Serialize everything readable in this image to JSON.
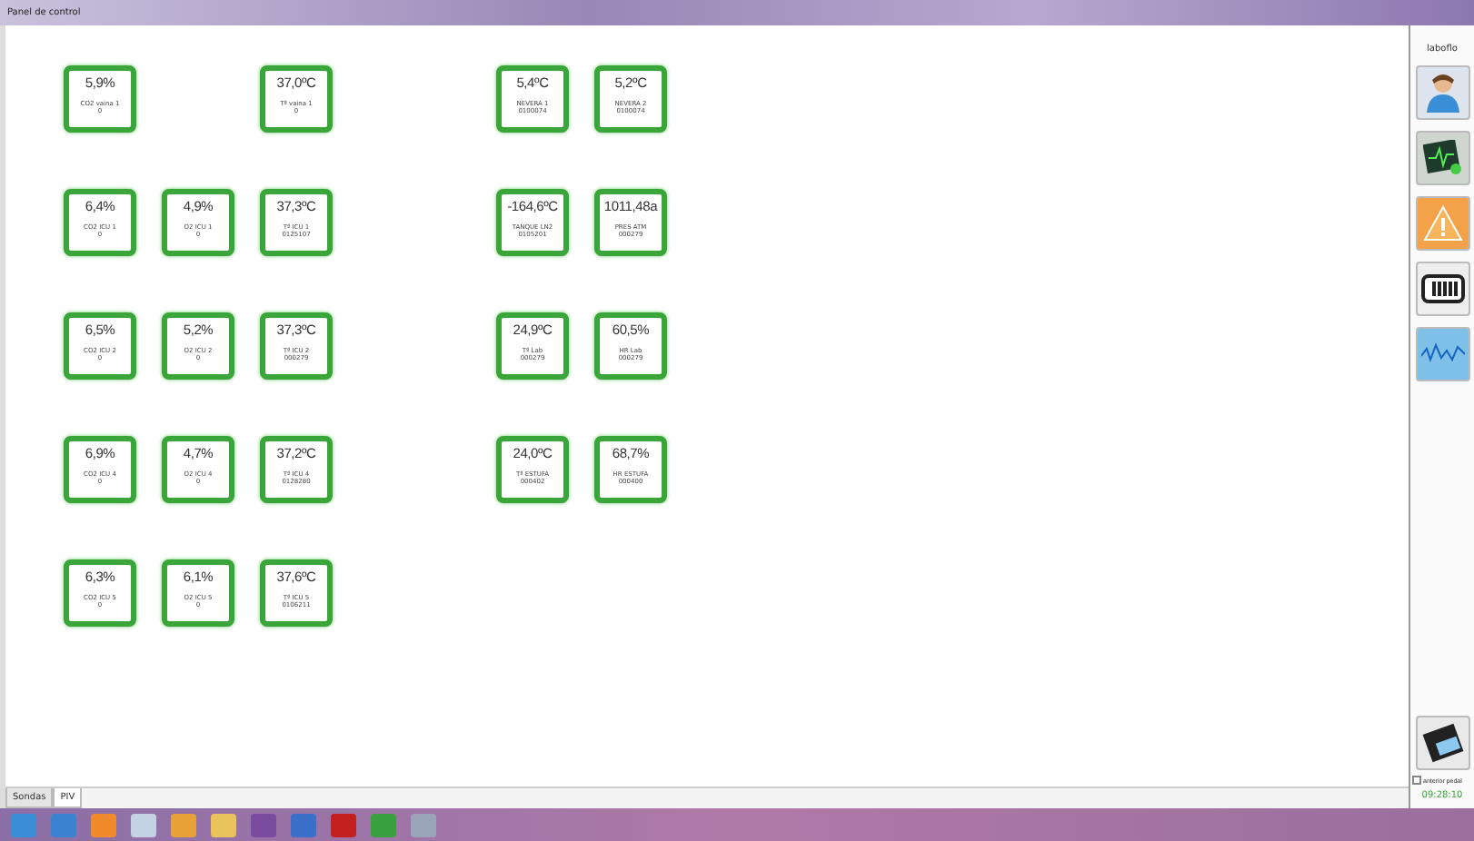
{
  "window": {
    "title": "Panel de control"
  },
  "rows": [
    {
      "left": [
        {
          "kind": "tile",
          "value": "5,9%",
          "label": "CO2 vaina 1",
          "code": "0"
        },
        {
          "kind": "empty"
        },
        {
          "kind": "tile",
          "value": "37,0ºC",
          "label": "Tª vaina 1",
          "code": "0"
        }
      ],
      "right": [
        {
          "kind": "tile",
          "value": "5,4ºC",
          "label": "NEVERA 1",
          "code": "0100074"
        },
        {
          "kind": "tile",
          "value": "5,2ºC",
          "label": "NEVERA 2",
          "code": "0100074"
        }
      ]
    },
    {
      "left": [
        {
          "kind": "tile",
          "value": "6,4%",
          "label": "CO2 ICU 1",
          "code": "0"
        },
        {
          "kind": "tile",
          "value": "4,9%",
          "label": "O2 ICU 1",
          "code": "0"
        },
        {
          "kind": "tile",
          "value": "37,3ºC",
          "label": "Tª ICU 1",
          "code": "0125107"
        }
      ],
      "right": [
        {
          "kind": "tile",
          "value": "-164,6ºC",
          "label": "TANQUE LN2",
          "code": "0105201"
        },
        {
          "kind": "tile",
          "value": "1011,48a",
          "label": "PRES ATM",
          "code": "000279"
        }
      ]
    },
    {
      "left": [
        {
          "kind": "tile",
          "value": "6,5%",
          "label": "CO2 ICU 2",
          "code": "0"
        },
        {
          "kind": "tile",
          "value": "5,2%",
          "label": "O2 ICU 2",
          "code": "0"
        },
        {
          "kind": "tile",
          "value": "37,3ºC",
          "label": "Tª ICU 2",
          "code": "000279"
        }
      ],
      "right": [
        {
          "kind": "tile",
          "value": "24,9ºC",
          "label": "Tª Lab",
          "code": "000279"
        },
        {
          "kind": "tile",
          "value": "60,5%",
          "label": "HR Lab",
          "code": "000279"
        }
      ]
    },
    {
      "left": [
        {
          "kind": "tile",
          "value": "6,9%",
          "label": "CO2 ICU 4",
          "code": "0"
        },
        {
          "kind": "tile",
          "value": "4,7%",
          "label": "O2 ICU 4",
          "code": "0"
        },
        {
          "kind": "tile",
          "value": "37,2ºC",
          "label": "Tª ICU 4",
          "code": "0128280"
        }
      ],
      "right": [
        {
          "kind": "tile",
          "value": "24,0ºC",
          "label": "Tª ESTUFA",
          "code": "000402"
        },
        {
          "kind": "tile",
          "value": "68,7%",
          "label": "HR ESTUFA",
          "code": "000400"
        }
      ]
    },
    {
      "left": [
        {
          "kind": "tile",
          "value": "6,3%",
          "label": "CO2 ICU 5",
          "code": "0"
        },
        {
          "kind": "tile",
          "value": "6,1%",
          "label": "O2 ICU 5",
          "code": "0"
        },
        {
          "kind": "tile",
          "value": "37,6ºC",
          "label": "Tª ICU 5",
          "code": "0106211"
        }
      ],
      "right": []
    }
  ],
  "sidebar": {
    "title": "laboflo",
    "option": {
      "label": "anterior pedal",
      "checked": false
    },
    "time": "09:28:10"
  },
  "tabs": [
    {
      "label": "Sondas",
      "selected": false
    },
    {
      "label": "PIV",
      "selected": true
    }
  ]
}
